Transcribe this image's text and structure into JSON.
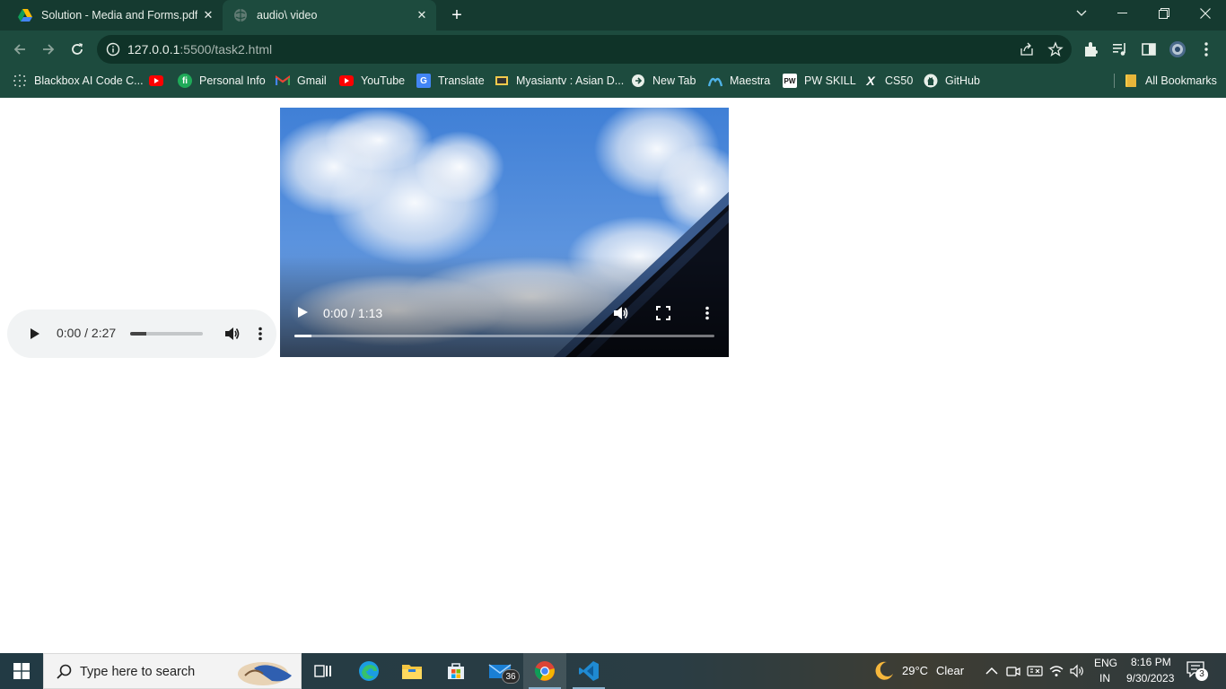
{
  "browser": {
    "tabs": [
      {
        "title": "Solution - Media and Forms.pdf",
        "icon": "google-drive-icon",
        "active": false
      },
      {
        "title": "audio\\ video",
        "icon": "globe-icon",
        "active": true
      }
    ],
    "url_host": "127.0.0.1",
    "url_rest": ":5500/task2.html",
    "bookmarks": [
      {
        "label": "Blackbox AI Code C...",
        "icon": "blackbox-icon"
      },
      {
        "label": "",
        "icon": "youtube-icon"
      },
      {
        "label": "Personal Info",
        "icon": "fi-icon"
      },
      {
        "label": "Gmail",
        "icon": "gmail-icon"
      },
      {
        "label": "YouTube",
        "icon": "youtube-icon"
      },
      {
        "label": "Translate",
        "icon": "google-translate-icon"
      },
      {
        "label": "Myasiantv : Asian D...",
        "icon": "myasiantv-icon"
      },
      {
        "label": "New Tab",
        "icon": "new-tab-icon"
      },
      {
        "label": "Maestra",
        "icon": "maestra-icon"
      },
      {
        "label": "PW SKILL",
        "icon": "pw-skill-icon"
      },
      {
        "label": "CS50",
        "icon": "x-icon"
      },
      {
        "label": "GitHub",
        "icon": "github-icon"
      }
    ],
    "all_bookmarks": "All Bookmarks",
    "theme_color": "#1d4b3e"
  },
  "page": {
    "audio": {
      "time": "0:00 / 2:27",
      "progress": 0.22
    },
    "video": {
      "time": "0:00 / 1:13",
      "progress": 0.04
    }
  },
  "taskbar": {
    "search_placeholder": "Type here to search",
    "mail_badge": "36",
    "weather_temp": "29°C",
    "weather_cond": "Clear",
    "lang_top": "ENG",
    "lang_bottom": "IN",
    "clock_time": "8:16 PM",
    "clock_date": "9/30/2023",
    "notif_count": "3"
  }
}
